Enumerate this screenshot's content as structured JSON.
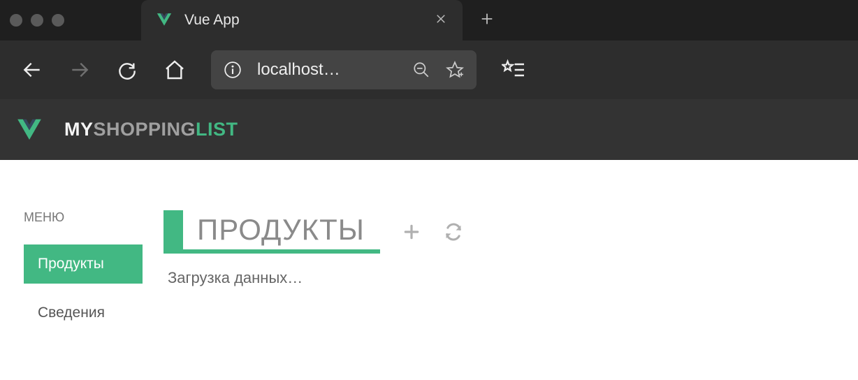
{
  "browser": {
    "tab_title": "Vue App",
    "address": "localhost…"
  },
  "app": {
    "brand": {
      "part1": "MY",
      "part2": "SHOPPING",
      "part3": "LIST"
    }
  },
  "sidebar": {
    "menu_label": "МЕНЮ",
    "items": [
      {
        "label": "Продукты",
        "active": true
      },
      {
        "label": "Сведения",
        "active": false
      }
    ]
  },
  "main": {
    "page_title": "ПРОДУКТЫ",
    "loading_text": "Загрузка данных…"
  },
  "colors": {
    "accent": "#42b883"
  }
}
